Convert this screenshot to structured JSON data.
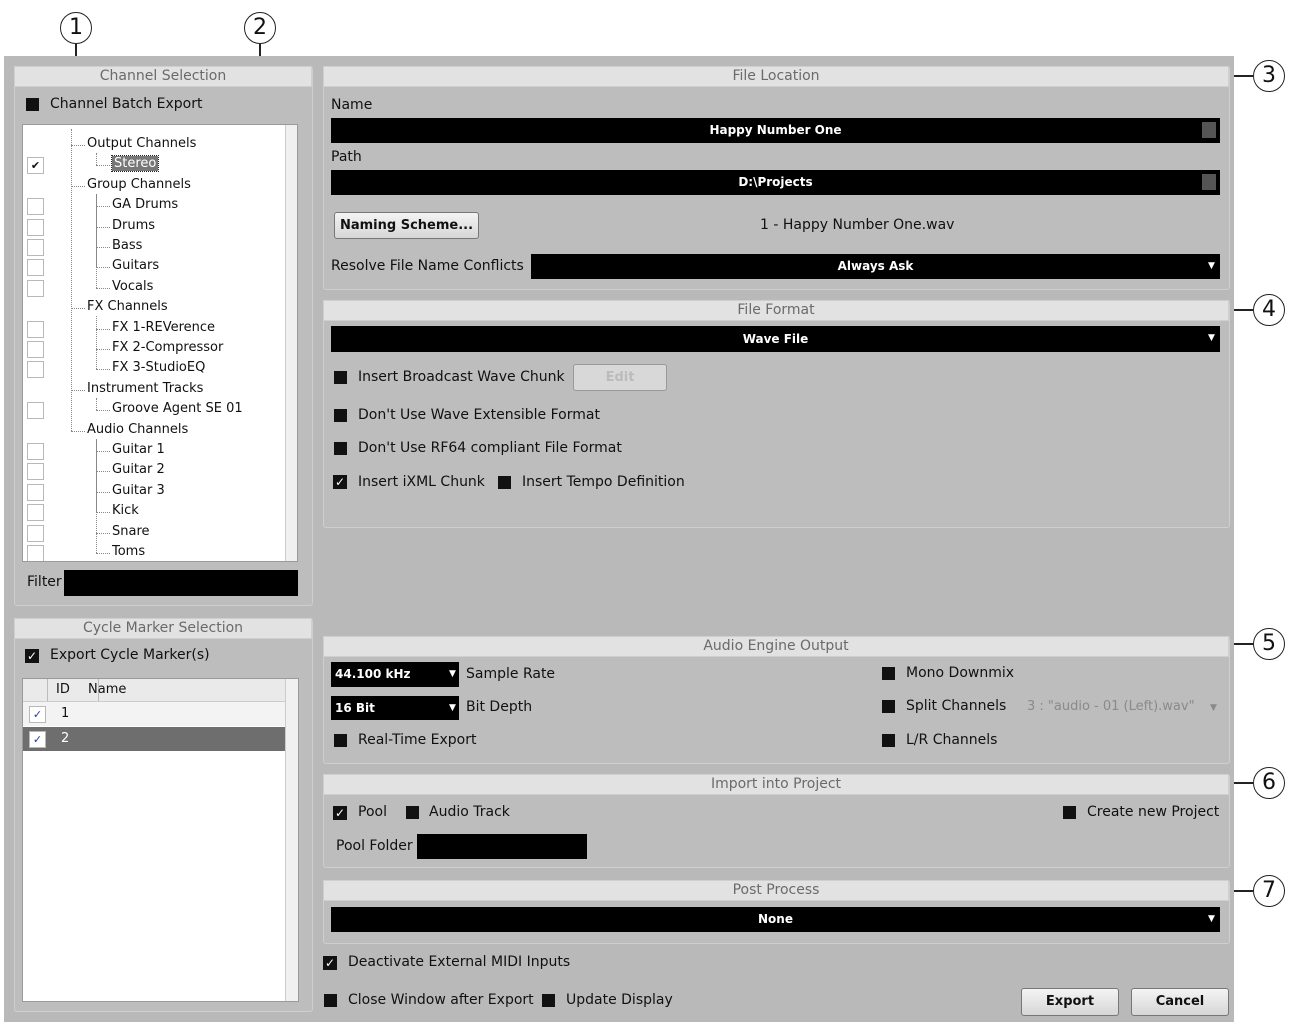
{
  "callouts": [
    "1",
    "2",
    "3",
    "4",
    "5",
    "6",
    "7"
  ],
  "channel_selection": {
    "title": "Channel Selection",
    "batch_export_label": "Channel Batch Export",
    "tree": [
      {
        "label": "Output Channels",
        "level": 0,
        "checkbox": false
      },
      {
        "label": "Stereo",
        "level": 1,
        "checkbox": true,
        "checked": true,
        "selected": true
      },
      {
        "label": "Group Channels",
        "level": 0,
        "checkbox": false
      },
      {
        "label": "GA Drums",
        "level": 1,
        "checkbox": true,
        "checked": false
      },
      {
        "label": "Drums",
        "level": 1,
        "checkbox": true,
        "checked": false
      },
      {
        "label": "Bass",
        "level": 1,
        "checkbox": true,
        "checked": false
      },
      {
        "label": "Guitars",
        "level": 1,
        "checkbox": true,
        "checked": false
      },
      {
        "label": "Vocals",
        "level": 1,
        "checkbox": true,
        "checked": false
      },
      {
        "label": "FX Channels",
        "level": 0,
        "checkbox": false
      },
      {
        "label": "FX 1-REVerence",
        "level": 1,
        "checkbox": true,
        "checked": false
      },
      {
        "label": "FX 2-Compressor",
        "level": 1,
        "checkbox": true,
        "checked": false
      },
      {
        "label": "FX 3-StudioEQ",
        "level": 1,
        "checkbox": true,
        "checked": false
      },
      {
        "label": "Instrument Tracks",
        "level": 0,
        "checkbox": false
      },
      {
        "label": "Groove Agent SE 01",
        "level": 1,
        "checkbox": true,
        "checked": false
      },
      {
        "label": "Audio Channels",
        "level": 0,
        "checkbox": false
      },
      {
        "label": "Guitar 1",
        "level": 1,
        "checkbox": true,
        "checked": false
      },
      {
        "label": "Guitar 2",
        "level": 1,
        "checkbox": true,
        "checked": false
      },
      {
        "label": "Guitar 3",
        "level": 1,
        "checkbox": true,
        "checked": false
      },
      {
        "label": "Kick",
        "level": 1,
        "checkbox": true,
        "checked": false
      },
      {
        "label": "Snare",
        "level": 1,
        "checkbox": true,
        "checked": false
      },
      {
        "label": "Toms",
        "level": 1,
        "checkbox": true,
        "checked": false
      }
    ],
    "filter_label": "Filter",
    "filter_value": ""
  },
  "cycle_marker": {
    "title": "Cycle Marker Selection",
    "export_label": "Export Cycle Marker(s)",
    "columns": [
      "ID",
      "Name"
    ],
    "rows": [
      {
        "id": "1",
        "name": "",
        "checked": true,
        "selected": false
      },
      {
        "id": "2",
        "name": "",
        "checked": true,
        "selected": true
      }
    ]
  },
  "file_location": {
    "title": "File Location",
    "name_label": "Name",
    "name_value": "Happy Number One",
    "path_label": "Path",
    "path_value": "D:\\Projects",
    "naming_scheme_button": "Naming Scheme...",
    "filename_preview": "1 - Happy Number One.wav",
    "resolve_label": "Resolve File Name Conflicts",
    "resolve_value": "Always Ask"
  },
  "file_format": {
    "title": "File Format",
    "format_value": "Wave File",
    "broadcast_label": "Insert Broadcast Wave Chunk",
    "edit_button": "Edit",
    "extensible_label": "Don't Use Wave Extensible Format",
    "rf64_label": "Don't Use RF64 compliant File Format",
    "ixml_label": "Insert iXML Chunk",
    "tempo_label": "Insert Tempo Definition"
  },
  "audio_engine": {
    "title": "Audio Engine Output",
    "sample_rate_value": "44.100 kHz",
    "sample_rate_label": "Sample Rate",
    "bit_depth_value": "16 Bit",
    "bit_depth_label": "Bit Depth",
    "realtime_label": "Real-Time Export",
    "mono_label": "Mono Downmix",
    "split_label": "Split Channels",
    "split_value": "3 : \"audio - 01 (Left).wav\"",
    "lr_label": "L/R Channels"
  },
  "import_project": {
    "title": "Import into Project",
    "pool_label": "Pool",
    "audio_track_label": "Audio Track",
    "create_project_label": "Create new Project",
    "pool_folder_label": "Pool Folder",
    "pool_folder_value": ""
  },
  "post_process": {
    "title": "Post Process",
    "value": "None"
  },
  "footer": {
    "deactivate_label": "Deactivate External MIDI Inputs",
    "close_label": "Close Window after Export",
    "update_label": "Update Display",
    "export_button": "Export",
    "cancel_button": "Cancel"
  }
}
